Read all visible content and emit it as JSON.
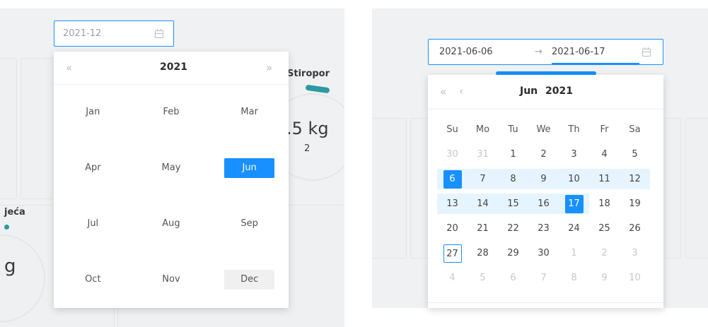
{
  "left": {
    "input_value": "2021-12",
    "year_label": "2021",
    "months": [
      "Jan",
      "Feb",
      "Mar",
      "Apr",
      "May",
      "Jun",
      "Jul",
      "Aug",
      "Sep",
      "Oct",
      "Nov",
      "Dec"
    ],
    "selected_month": "Jun",
    "current_month": "Dec",
    "bg_title_1": "Stiropor",
    "bg_value_1": ".5 kg",
    "bg_sub_1": "2",
    "bg_title_2": "jeća",
    "bg_value_2": "g"
  },
  "right": {
    "start_value": "2021-06-06",
    "separator": "→",
    "end_value": "2021-06-17",
    "month_label": "Jun",
    "year_label": "2021",
    "weekdays": [
      "Su",
      "Mo",
      "Tu",
      "We",
      "Th",
      "Fr",
      "Sa"
    ],
    "rows": [
      [
        "30",
        "31",
        "1",
        "2",
        "3",
        "4",
        "5"
      ],
      [
        "6",
        "7",
        "8",
        "9",
        "10",
        "11",
        "12"
      ],
      [
        "13",
        "14",
        "15",
        "16",
        "17",
        "18",
        "19"
      ],
      [
        "20",
        "21",
        "22",
        "23",
        "24",
        "25",
        "26"
      ],
      [
        "27",
        "28",
        "29",
        "30",
        "1",
        "2",
        "3"
      ],
      [
        "4",
        "5",
        "6",
        "7",
        "8",
        "9",
        "10"
      ]
    ]
  },
  "nav": {
    "super_prev": "«",
    "prev": "‹",
    "super_next": "»"
  },
  "colors": {
    "accent": "#1890ff",
    "range": "#e6f4ff",
    "teal": "#2c9aa0"
  }
}
